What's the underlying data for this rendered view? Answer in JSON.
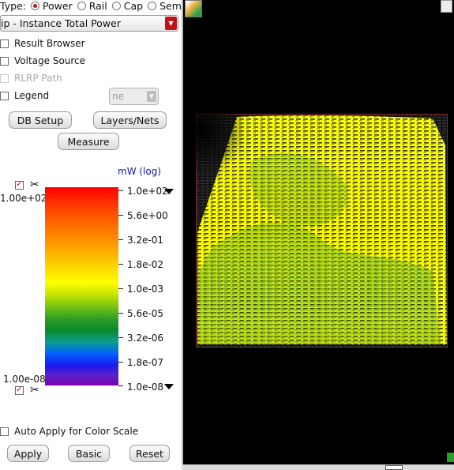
{
  "type_row": {
    "label": "Type:",
    "options": [
      {
        "label": "Power",
        "selected": true
      },
      {
        "label": "Rail",
        "selected": false
      },
      {
        "label": "Cap",
        "selected": false
      },
      {
        "label": "Sem",
        "selected": false
      }
    ]
  },
  "analysis_select": {
    "value": "ip - Instance Total Power"
  },
  "checkboxes": {
    "result_browser": {
      "label": "Result Browser",
      "checked": false
    },
    "voltage_source": {
      "label": "Voltage Source",
      "checked": false
    },
    "rlrp_path": {
      "label": "RLRP Path",
      "checked": false,
      "disabled": true
    },
    "legend": {
      "label": "Legend",
      "checked": false
    }
  },
  "legend_dropdown": {
    "value": "ne"
  },
  "buttons": {
    "db_setup": "DB Setup",
    "layers_nets": "Layers/Nets",
    "measure": "Measure",
    "apply": "Apply",
    "basic": "Basic",
    "reset": "Reset"
  },
  "color_scale": {
    "unit": "mW  (log)",
    "max_value": "1.00e+02",
    "min_value": "1.00e-08",
    "ticks": [
      "1.0e+02",
      "5.6e+00",
      "3.2e-01",
      "1.8e-02",
      "1.0e-03",
      "5.6e-05",
      "3.2e-06",
      "1.8e-07",
      "1.0e-08"
    ],
    "upper_enabled": true,
    "lower_enabled": true
  },
  "auto_apply": {
    "label": "Auto Apply for Color Scale",
    "checked": false
  },
  "colors": {
    "accent": "#c0141c",
    "viewer_background": "#000000",
    "map_primary": "#ffff00",
    "map_secondary": "#2a9a26"
  }
}
